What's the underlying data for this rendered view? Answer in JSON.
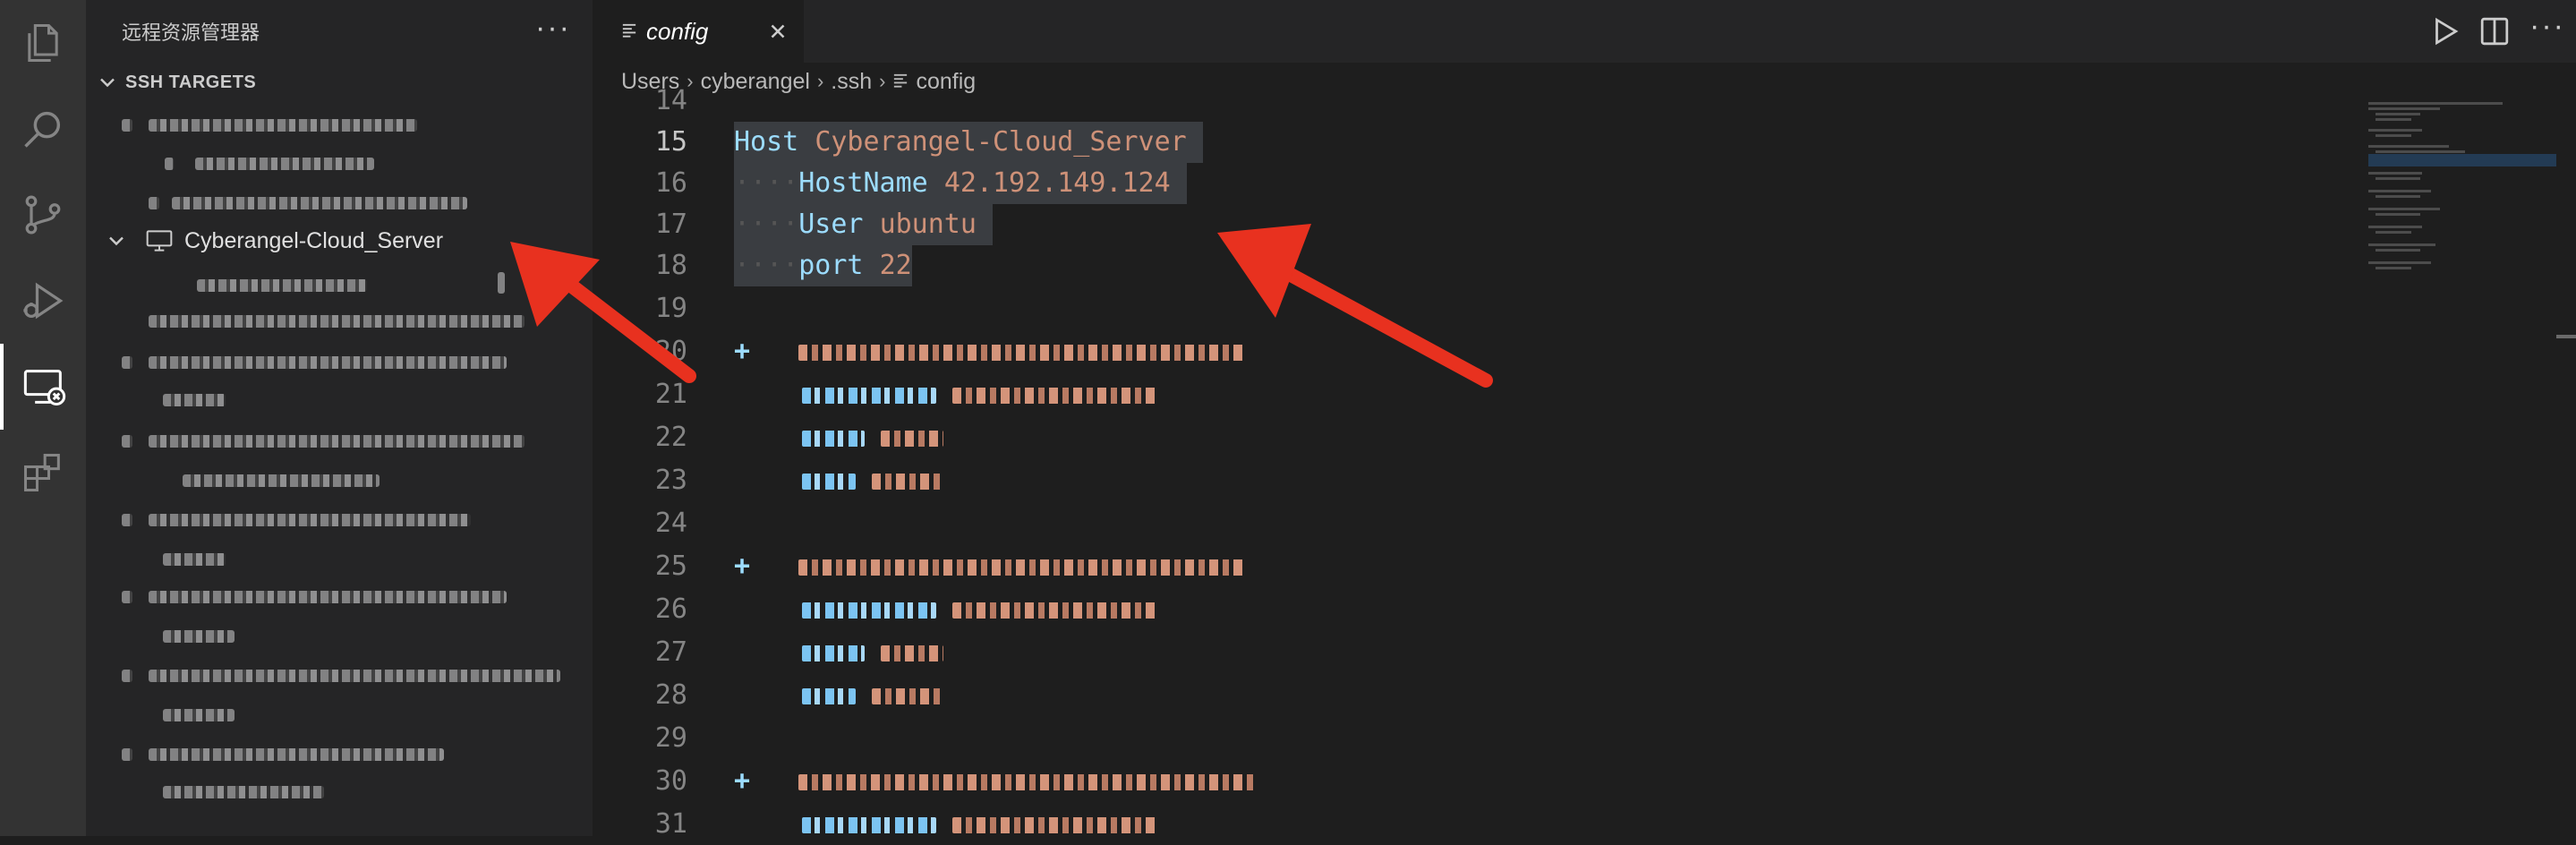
{
  "sidebar": {
    "title": "远程资源管理器",
    "more": "···",
    "section_label": "SSH TARGETS",
    "highlighted_host": "Cyberangel-Cloud_Server"
  },
  "tab": {
    "label": "config"
  },
  "editor_more": "···",
  "breadcrumb": [
    "Users",
    "cyberangel",
    ".ssh",
    "config"
  ],
  "code": {
    "partial_top_line": "14",
    "lines": [
      {
        "n": "15",
        "key": "Host",
        "value": "Cyberangel-Cloud_Server",
        "indent": ""
      },
      {
        "n": "16",
        "key": "HostName",
        "value": "42.192.149.124",
        "indent": "····"
      },
      {
        "n": "17",
        "key": "User",
        "value": "ubuntu",
        "indent": "····"
      },
      {
        "n": "18",
        "key": "port",
        "value": "22",
        "indent": "····"
      }
    ],
    "other_line_numbers": [
      "19",
      "20",
      "21",
      "22",
      "23",
      "24",
      "25",
      "26",
      "27",
      "28",
      "29",
      "30",
      "31"
    ]
  },
  "colors": {
    "arrow": "#e8311f",
    "keyword": "#9cdcfe",
    "string": "#ce9178",
    "selection": "#3a3d41"
  }
}
